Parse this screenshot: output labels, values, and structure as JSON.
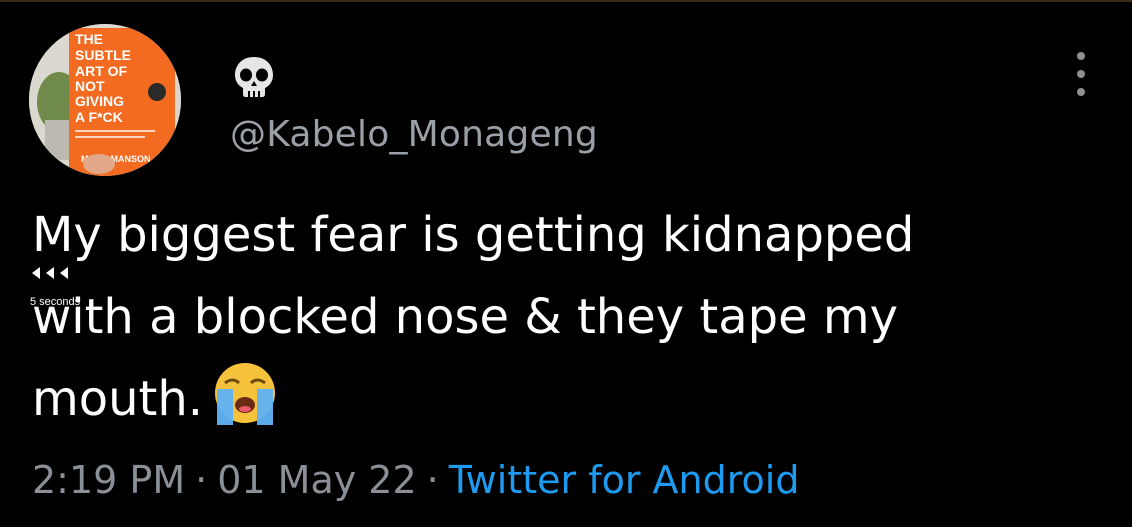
{
  "tweet": {
    "avatar": {
      "book_title_lines": [
        "THE",
        "SUBTLE",
        "ART OF",
        "NOT",
        "GIVING",
        "A F*CK"
      ],
      "book_author": "MARK MANSON",
      "book_color": "#f36b21"
    },
    "display_name_icon": "skull-emoji",
    "handle": "@Kabelo_Monageng",
    "more_icon": "more-vertical-icon",
    "text_lines": [
      "My biggest fear is getting kidnapped",
      "with a blocked nose & they tape my",
      "mouth."
    ],
    "text_emoji": "loudly-crying-face-emoji",
    "time": "2:19 PM",
    "date": "01 May 22",
    "separator": "·",
    "source": "Twitter for Android",
    "source_color": "#1d9bf0"
  },
  "video_overlay": {
    "rewind_icon": "rewind-icon",
    "seconds_label": "5 seconds"
  }
}
